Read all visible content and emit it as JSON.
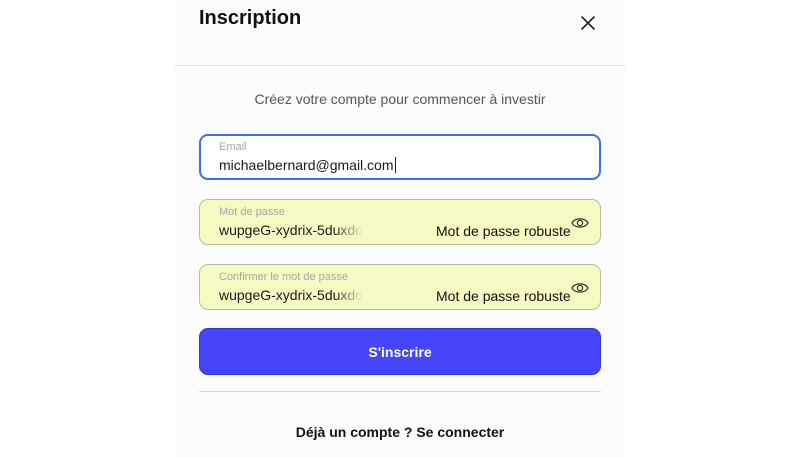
{
  "modal": {
    "title": "Inscription",
    "close_icon": "close-icon",
    "subtitle": "Créez votre compte pour commencer à investir"
  },
  "form": {
    "email": {
      "label": "Email",
      "value": "michaelbernard@gmail.com"
    },
    "password": {
      "label": "Mot de passe",
      "value": "wupgeG-xydrix-5duxdo",
      "strength": "Mot de passe robuste",
      "icon": "eye-icon"
    },
    "confirm_password": {
      "label": "Confirmer le mot de passe",
      "value": "wupgeG-xydrix-5duxdo",
      "strength": "Mot de passe robuste",
      "icon": "eye-icon"
    },
    "submit_label": "S'inscrire"
  },
  "footer": {
    "login_link": "Déjà un compte ? Se connecter"
  },
  "colors": {
    "primary_button": "#4545fb",
    "focus_border": "#3d6fe0",
    "autofill_background": "#f7f9c3"
  }
}
